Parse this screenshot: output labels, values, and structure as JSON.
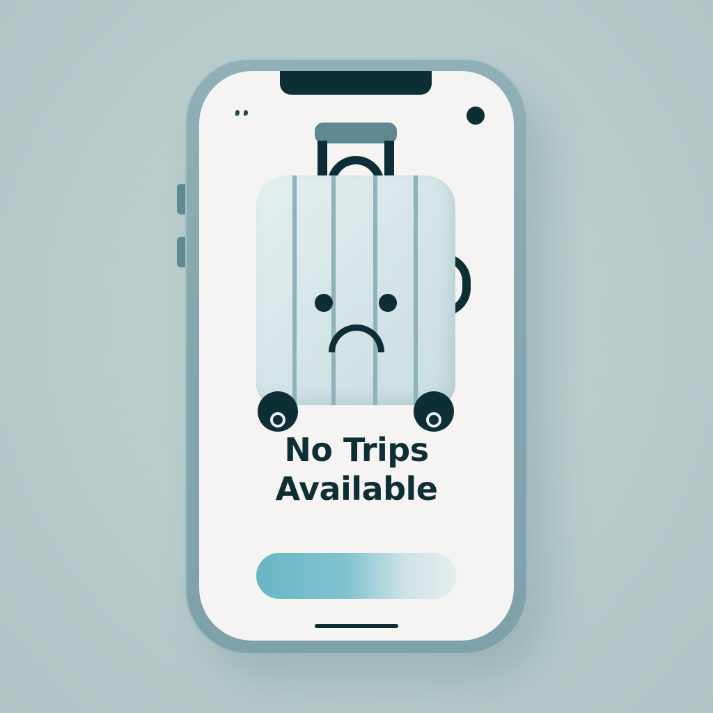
{
  "empty_state": {
    "message": "No Trips\nAvailable",
    "illustration_icon": "sad-suitcase-icon"
  },
  "status_bar": {
    "left_icon": "status-dots-icon",
    "right_icon": "camera-dot-icon"
  },
  "colors": {
    "background": "#b9cccd",
    "frame": "#83a7ae",
    "screen": "#f5f4f2",
    "ink": "#0e2e35",
    "accent": "#69b6c6"
  }
}
